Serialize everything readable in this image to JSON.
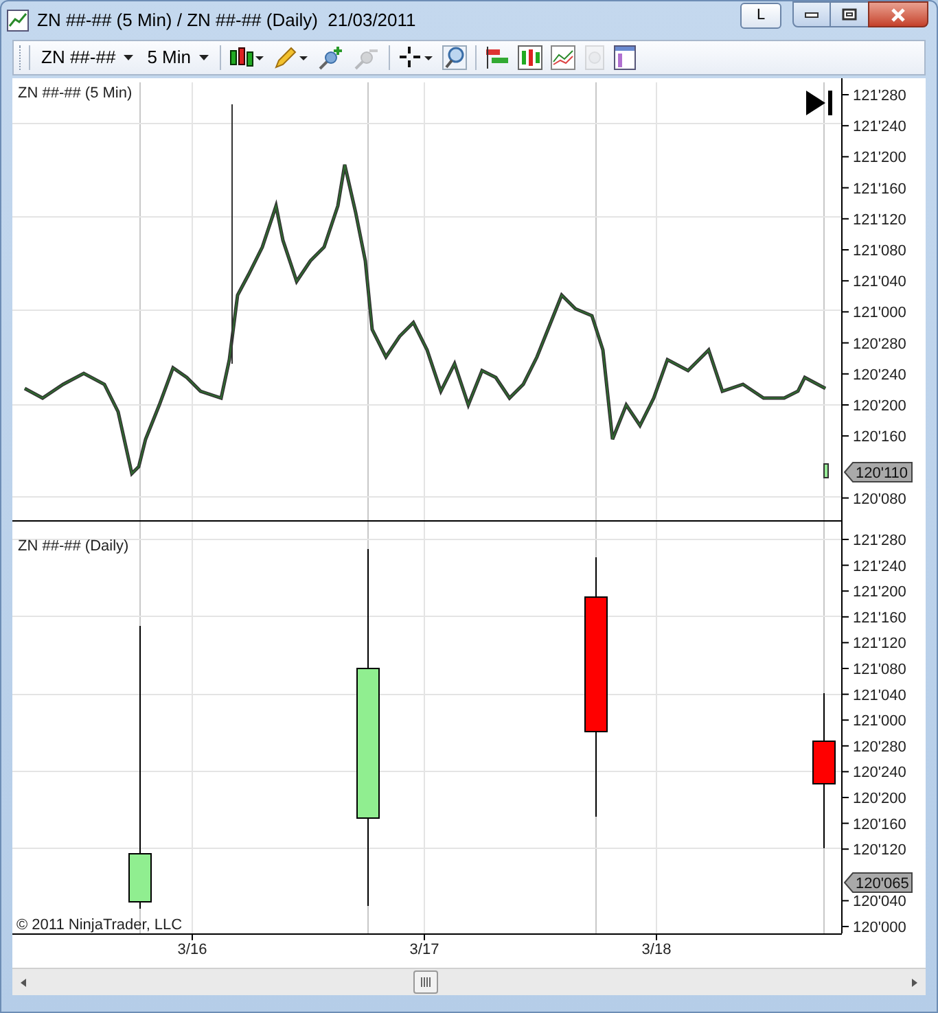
{
  "window": {
    "title": "ZN ##-## (5 Min) / ZN ##-## (Daily)  21/03/2011",
    "buttons": [
      {
        "kind": "text",
        "label": "L"
      },
      {
        "kind": "minimize"
      },
      {
        "kind": "maximize"
      },
      {
        "kind": "close"
      }
    ]
  },
  "toolbar": {
    "instrument": "ZN ##-##",
    "interval": "5 Min",
    "tools": [
      {
        "kind": "candles",
        "disabled": false
      },
      {
        "kind": "pencil",
        "disabled": false
      },
      {
        "kind": "add",
        "disabled": false
      },
      {
        "kind": "remove",
        "disabled": true
      },
      {
        "kind": "crosshair",
        "disabled": false
      },
      {
        "kind": "zoom",
        "disabled": false
      },
      {
        "kind": "strategy",
        "disabled": false
      },
      {
        "kind": "bars",
        "disabled": false
      },
      {
        "kind": "indicator",
        "disabled": false
      },
      {
        "kind": "dollar",
        "disabled": true
      },
      {
        "kind": "properties",
        "disabled": false
      }
    ]
  },
  "panels": [
    {
      "kind": "intraday",
      "label": "ZN ##-## (5 Min)",
      "price_marker": "120'110",
      "y_ticks": [
        "121'280",
        "121'240",
        "121'200",
        "121'160",
        "121'120",
        "121'080",
        "121'040",
        "121'000",
        "120'280",
        "120'240",
        "120'200",
        "120'160",
        "120'080"
      ]
    },
    {
      "kind": "daily",
      "label": "ZN ##-## (Daily)",
      "price_marker": "120'065",
      "y_ticks": [
        "121'280",
        "121'240",
        "121'200",
        "121'160",
        "121'120",
        "121'080",
        "121'040",
        "121'000",
        "120'280",
        "120'240",
        "120'200",
        "120'160",
        "120'120",
        "120'040",
        "120'000"
      ],
      "candles": [
        {
          "color": "#90ee90"
        },
        {
          "color": "#90ee90"
        },
        {
          "color": "#ff0000"
        },
        {
          "color": "#ff0000"
        }
      ]
    }
  ],
  "x_labels": [
    "3/16",
    "3/17",
    "3/18"
  ],
  "copyright": "© 2011 NinjaTrader, LLC"
}
